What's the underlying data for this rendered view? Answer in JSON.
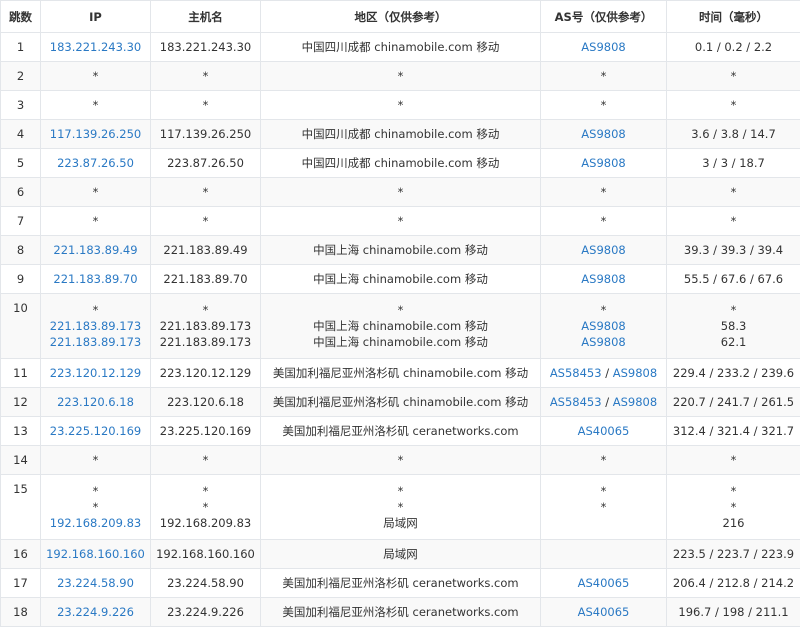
{
  "table": {
    "headers": [
      "跳数",
      "IP",
      "主机名",
      "地区（仅供参考）",
      "AS号（仅供参考）",
      "时间（毫秒）"
    ],
    "rows": [
      {
        "hop": "1",
        "ip": [
          "183.221.243.30"
        ],
        "host": [
          "183.221.243.30"
        ],
        "region": [
          "中国四川成都 chinamobile.com 移动"
        ],
        "as": [
          [
            "AS9808"
          ]
        ],
        "time": [
          "0.1 / 0.2 / 2.2"
        ]
      },
      {
        "hop": "2",
        "ip": [
          "*"
        ],
        "host": [
          "*"
        ],
        "region": [
          "*"
        ],
        "as": [
          [
            "*"
          ]
        ],
        "time": [
          "*"
        ]
      },
      {
        "hop": "3",
        "ip": [
          "*"
        ],
        "host": [
          "*"
        ],
        "region": [
          "*"
        ],
        "as": [
          [
            "*"
          ]
        ],
        "time": [
          "*"
        ]
      },
      {
        "hop": "4",
        "ip": [
          "117.139.26.250"
        ],
        "host": [
          "117.139.26.250"
        ],
        "region": [
          "中国四川成都 chinamobile.com 移动"
        ],
        "as": [
          [
            "AS9808"
          ]
        ],
        "time": [
          "3.6 / 3.8 / 14.7"
        ]
      },
      {
        "hop": "5",
        "ip": [
          "223.87.26.50"
        ],
        "host": [
          "223.87.26.50"
        ],
        "region": [
          "中国四川成都 chinamobile.com 移动"
        ],
        "as": [
          [
            "AS9808"
          ]
        ],
        "time": [
          "3 / 3 / 18.7"
        ]
      },
      {
        "hop": "6",
        "ip": [
          "*"
        ],
        "host": [
          "*"
        ],
        "region": [
          "*"
        ],
        "as": [
          [
            "*"
          ]
        ],
        "time": [
          "*"
        ]
      },
      {
        "hop": "7",
        "ip": [
          "*"
        ],
        "host": [
          "*"
        ],
        "region": [
          "*"
        ],
        "as": [
          [
            "*"
          ]
        ],
        "time": [
          "*"
        ]
      },
      {
        "hop": "8",
        "ip": [
          "221.183.89.49"
        ],
        "host": [
          "221.183.89.49"
        ],
        "region": [
          "中国上海 chinamobile.com 移动"
        ],
        "as": [
          [
            "AS9808"
          ]
        ],
        "time": [
          "39.3 / 39.3 / 39.4"
        ]
      },
      {
        "hop": "9",
        "ip": [
          "221.183.89.70"
        ],
        "host": [
          "221.183.89.70"
        ],
        "region": [
          "中国上海 chinamobile.com 移动"
        ],
        "as": [
          [
            "AS9808"
          ]
        ],
        "time": [
          "55.5 / 67.6 / 67.6"
        ]
      },
      {
        "hop": "10",
        "ip": [
          "*",
          "221.183.89.173",
          "221.183.89.173"
        ],
        "host": [
          "*",
          "221.183.89.173",
          "221.183.89.173"
        ],
        "region": [
          "*",
          "中国上海 chinamobile.com 移动",
          "中国上海 chinamobile.com 移动"
        ],
        "as": [
          [
            "*"
          ],
          [
            "AS9808"
          ],
          [
            "AS9808"
          ]
        ],
        "time": [
          "*",
          "58.3",
          "62.1"
        ]
      },
      {
        "hop": "11",
        "ip": [
          "223.120.12.129"
        ],
        "host": [
          "223.120.12.129"
        ],
        "region": [
          "美国加利福尼亚州洛杉矶 chinamobile.com 移动"
        ],
        "as": [
          [
            "AS58453",
            "AS9808"
          ]
        ],
        "time": [
          "229.4 / 233.2 / 239.6"
        ]
      },
      {
        "hop": "12",
        "ip": [
          "223.120.6.18"
        ],
        "host": [
          "223.120.6.18"
        ],
        "region": [
          "美国加利福尼亚州洛杉矶 chinamobile.com 移动"
        ],
        "as": [
          [
            "AS58453",
            "AS9808"
          ]
        ],
        "time": [
          "220.7 / 241.7 / 261.5"
        ]
      },
      {
        "hop": "13",
        "ip": [
          "23.225.120.169"
        ],
        "host": [
          "23.225.120.169"
        ],
        "region": [
          "美国加利福尼亚州洛杉矶 ceranetworks.com"
        ],
        "as": [
          [
            "AS40065"
          ]
        ],
        "time": [
          "312.4 / 321.4 / 321.7"
        ]
      },
      {
        "hop": "14",
        "ip": [
          "*"
        ],
        "host": [
          "*"
        ],
        "region": [
          "*"
        ],
        "as": [
          [
            "*"
          ]
        ],
        "time": [
          "*"
        ]
      },
      {
        "hop": "15",
        "ip": [
          "*",
          "*",
          "192.168.209.83"
        ],
        "host": [
          "*",
          "*",
          "192.168.209.83"
        ],
        "region": [
          "*",
          "*",
          "局域网"
        ],
        "as": [
          [
            "*"
          ],
          [
            "*"
          ],
          [
            ""
          ]
        ],
        "time": [
          "*",
          "*",
          "216"
        ]
      },
      {
        "hop": "16",
        "ip": [
          "192.168.160.160"
        ],
        "host": [
          "192.168.160.160"
        ],
        "region": [
          "局域网"
        ],
        "as": [
          [
            ""
          ]
        ],
        "time": [
          "223.5 / 223.7 / 223.9"
        ]
      },
      {
        "hop": "17",
        "ip": [
          "23.224.58.90"
        ],
        "host": [
          "23.224.58.90"
        ],
        "region": [
          "美国加利福尼亚州洛杉矶 ceranetworks.com"
        ],
        "as": [
          [
            "AS40065"
          ]
        ],
        "time": [
          "206.4 / 212.8 / 214.2"
        ]
      },
      {
        "hop": "18",
        "ip": [
          "23.224.9.226"
        ],
        "host": [
          "23.224.9.226"
        ],
        "region": [
          "美国加利福尼亚州洛杉矶 ceranetworks.com"
        ],
        "as": [
          [
            "AS40065"
          ]
        ],
        "time": [
          "196.7 / 198 / 211.1"
        ]
      }
    ]
  },
  "colors": {
    "link": "#2a79c4",
    "border": "#e3e6ea",
    "stripe": "#f9f9f9",
    "text": "#333333"
  }
}
